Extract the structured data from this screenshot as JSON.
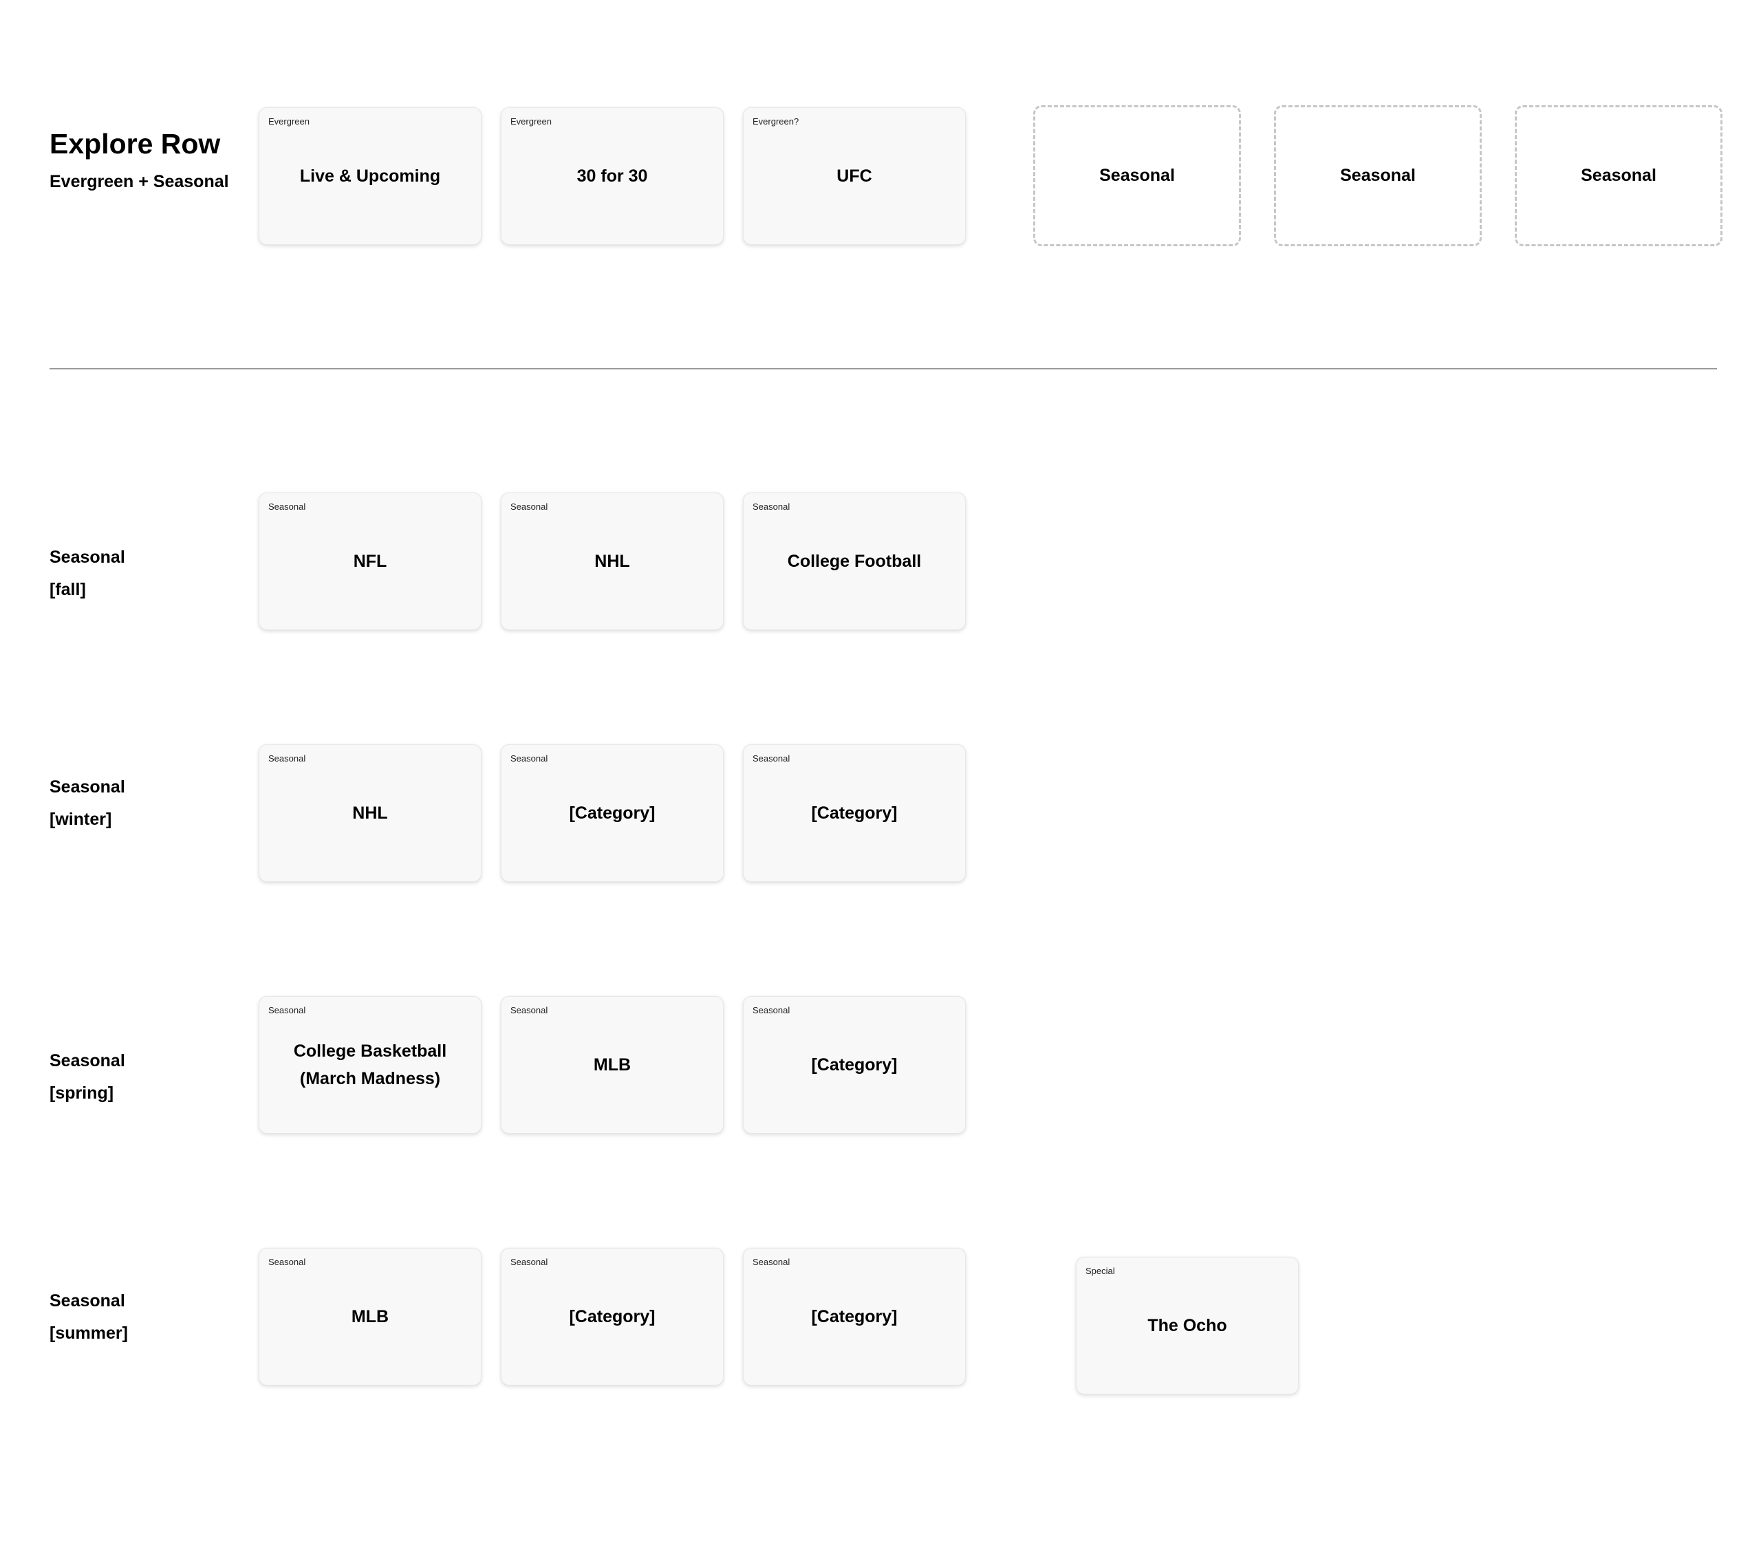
{
  "explore": {
    "title": "Explore Row",
    "subtitle": "Evergreen + Seasonal",
    "cards": [
      {
        "tag": "Evergreen",
        "title": "Live & Upcoming"
      },
      {
        "tag": "Evergreen",
        "title": "30 for 30"
      },
      {
        "tag": "Evergreen?",
        "title": "UFC"
      }
    ],
    "slots": [
      {
        "title": "Seasonal"
      },
      {
        "title": "Seasonal"
      },
      {
        "title": "Seasonal"
      }
    ]
  },
  "seasons": [
    {
      "label": "Seasonal",
      "season": "[fall]",
      "cards": [
        {
          "tag": "Seasonal",
          "title": "NFL"
        },
        {
          "tag": "Seasonal",
          "title": "NHL"
        },
        {
          "tag": "Seasonal",
          "title": "College Football"
        }
      ]
    },
    {
      "label": "Seasonal",
      "season": "[winter]",
      "cards": [
        {
          "tag": "Seasonal",
          "title": "NHL"
        },
        {
          "tag": "Seasonal",
          "title": "[Category]"
        },
        {
          "tag": "Seasonal",
          "title": "[Category]"
        }
      ]
    },
    {
      "label": "Seasonal",
      "season": "[spring]",
      "cards": [
        {
          "tag": "Seasonal",
          "title": "College Basketball\n(March Madness)"
        },
        {
          "tag": "Seasonal",
          "title": "MLB"
        },
        {
          "tag": "Seasonal",
          "title": "[Category]"
        }
      ]
    },
    {
      "label": "Seasonal",
      "season": "[summer]",
      "cards": [
        {
          "tag": "Seasonal",
          "title": "MLB"
        },
        {
          "tag": "Seasonal",
          "title": "[Category]"
        },
        {
          "tag": "Seasonal",
          "title": "[Category]"
        }
      ]
    }
  ],
  "special": {
    "tag": "Special",
    "title": "The Ocho"
  }
}
